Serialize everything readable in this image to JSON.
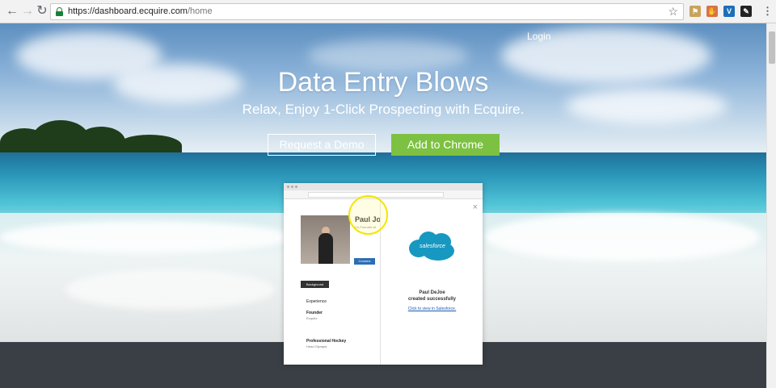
{
  "browser": {
    "url_host": "https://dashboard.ecquire.com",
    "url_path": "/home",
    "icons": [
      "back-icon",
      "forward-icon",
      "reload-icon",
      "lock-icon",
      "star-icon",
      "menu-icon"
    ]
  },
  "header": {
    "login": "Login"
  },
  "hero": {
    "title": "Data Entry Blows",
    "subtitle": "Relax, Enjoy 1-Click Prospecting with Ecquire.",
    "demo_button": "Request a Demo",
    "chrome_button": "Add to Chrome"
  },
  "mockup": {
    "profile_name": "Paul Jo",
    "profile_title": "Co-Founder at",
    "connect": "Connect",
    "background_tab": "Background",
    "experience": "Experience",
    "job1_title": "Founder",
    "job1_company": "Ecquire",
    "job2_title": "Professional Hockey",
    "job2_company": "Head Olympia",
    "popup": {
      "brand": "salesforce",
      "message_name": "Paul DeJoe",
      "message_status": "created successfully",
      "link": "Click to view in Salesforce."
    }
  },
  "colors": {
    "accent_green": "#7dc142",
    "salesforce_blue": "#1798c1",
    "footer": "#3a3f45"
  }
}
